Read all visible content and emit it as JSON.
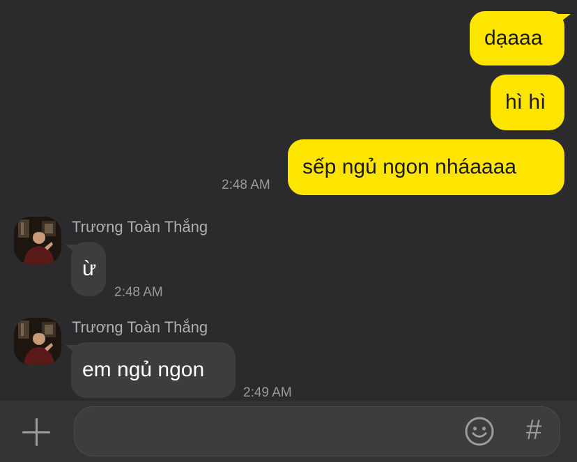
{
  "messages": [
    {
      "direction": "out",
      "text": "dạaaa"
    },
    {
      "direction": "out",
      "text": "hì hì"
    },
    {
      "direction": "out",
      "text": "sếp ngủ ngon nháaaaa",
      "time": "2:48 AM"
    },
    {
      "direction": "in",
      "sender": "Trương Toàn Thắng",
      "text": "ừ",
      "time": "2:48 AM"
    },
    {
      "direction": "in",
      "sender": "Trương Toàn Thắng",
      "text": "em ngủ ngon",
      "time": "2:49 AM"
    }
  ],
  "input_bar": {
    "placeholder": "",
    "plus_icon": "plus-icon",
    "emoji_icon": "smiley-emoji-icon",
    "hash_icon": "hashtag-icon",
    "hash_glyph": "#"
  },
  "colors": {
    "background": "#2b2b2d",
    "outgoing_bubble": "#fee500",
    "incoming_bubble": "#3d3d40",
    "timestamp": "#9a9a9d",
    "input_bar": "#333336"
  }
}
